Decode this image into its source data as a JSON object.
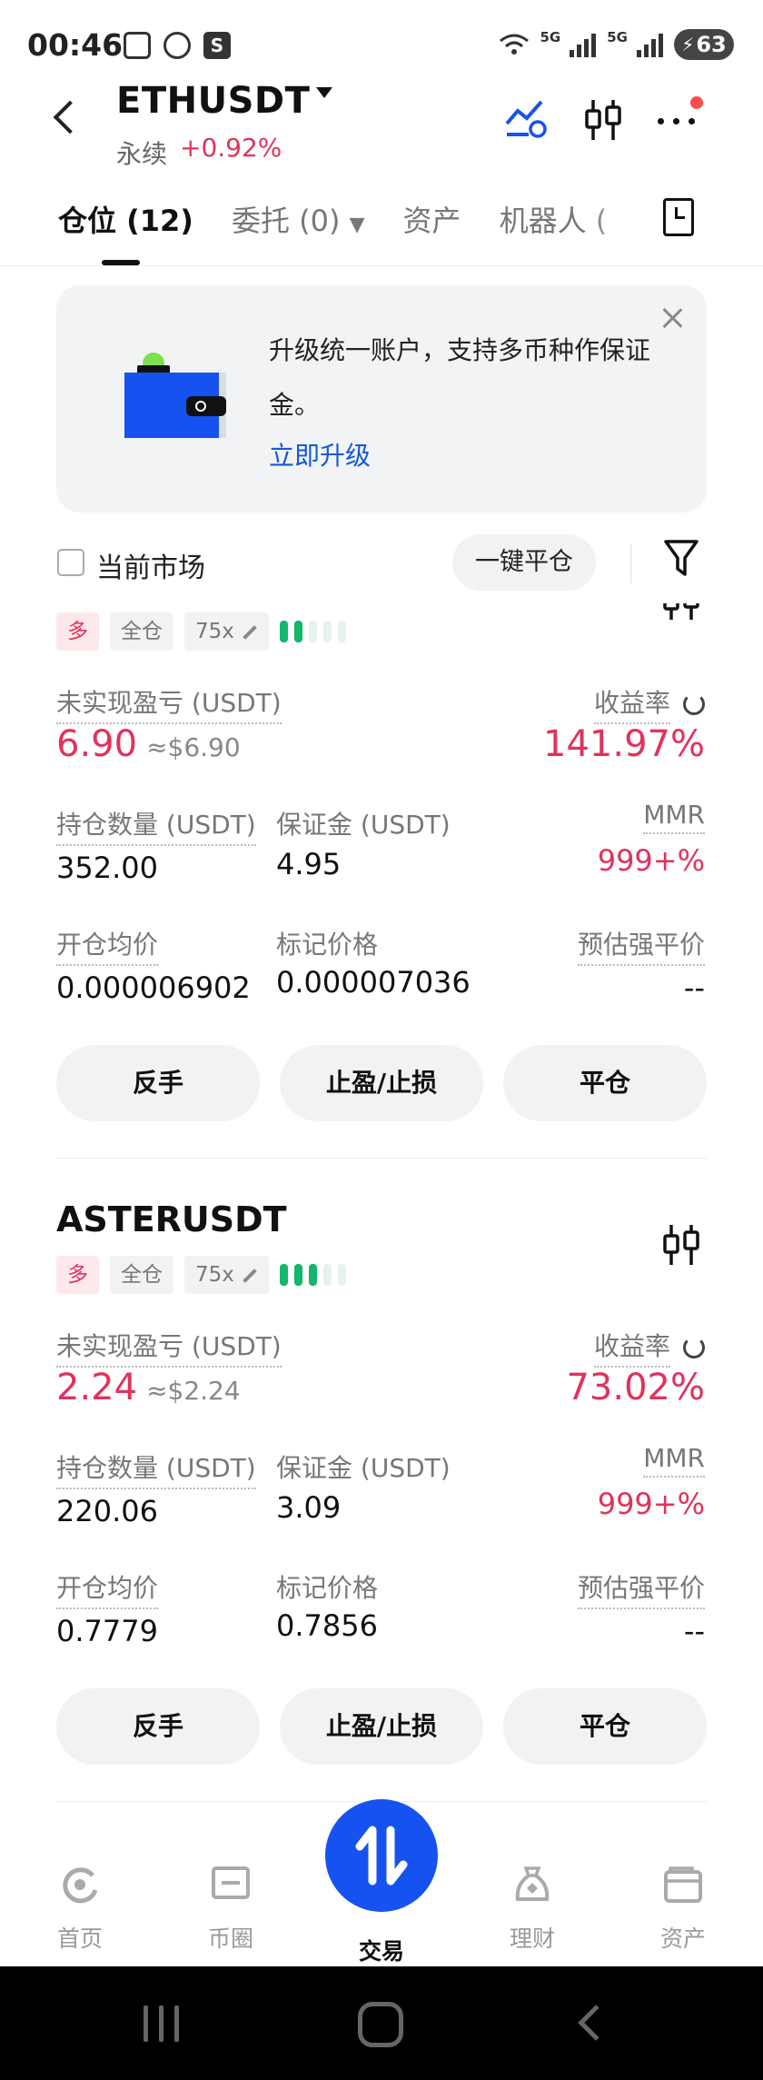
{
  "status_bar": {
    "time": "00:46",
    "network_1": "5G",
    "network_2": "5G",
    "battery": "63"
  },
  "header": {
    "pair": "ETHUSDT",
    "contract_type": "永续",
    "change_pct": "+0.92%"
  },
  "tabs": [
    {
      "label": "仓位 (12)",
      "active": true
    },
    {
      "label": "委托 (0)",
      "active": false
    },
    {
      "label": "资产",
      "active": false
    },
    {
      "label": "机器人 (",
      "active": false
    }
  ],
  "banner": {
    "text": "升级统一账户，支持多币种作保证金。",
    "link": "立即升级"
  },
  "filter": {
    "current_market_label": "当前市场",
    "one_click_close": "一键平仓"
  },
  "labels": {
    "unrealized_pnl": "未实现盈亏 (USDT)",
    "roi": "收益率",
    "position_size": "持仓数量 (USDT)",
    "margin": "保证金 (USDT)",
    "mmr": "MMR",
    "entry_price": "开仓均价",
    "mark_price": "标记价格",
    "est_liq_price": "预估强平价"
  },
  "buttons": {
    "reverse": "反手",
    "tp_sl": "止盈/止损",
    "close": "平仓"
  },
  "positions": [
    {
      "symbol": "",
      "side": "多",
      "margin_mode": "全仓",
      "leverage": "75x",
      "mmr_level": 2,
      "unrealized_pnl": "6.90",
      "unrealized_pnl_usd": "≈$6.90",
      "roi": "141.97%",
      "position_size": "352.00",
      "margin": "4.95",
      "mmr": "999+%",
      "entry_price": "0.000006902",
      "mark_price": "0.000007036",
      "est_liq_price": "--"
    },
    {
      "symbol": "ASTERUSDT",
      "side": "多",
      "margin_mode": "全仓",
      "leverage": "75x",
      "mmr_level": 3,
      "unrealized_pnl": "2.24",
      "unrealized_pnl_usd": "≈$2.24",
      "roi": "73.02%",
      "position_size": "220.06",
      "margin": "3.09",
      "mmr": "999+%",
      "entry_price": "0.7779",
      "mark_price": "0.7856",
      "est_liq_price": "--"
    }
  ],
  "bottom_nav": [
    {
      "label": "首页",
      "icon": "home-icon"
    },
    {
      "label": "币圈",
      "icon": "community-icon"
    },
    {
      "label": "交易",
      "icon": "trade-icon",
      "active": true
    },
    {
      "label": "理财",
      "icon": "earn-icon"
    },
    {
      "label": "资产",
      "icon": "assets-icon"
    }
  ],
  "colors": {
    "positive": "#e0335c",
    "accent_blue": "#1652f0",
    "mmr_green": "#12b76a"
  }
}
